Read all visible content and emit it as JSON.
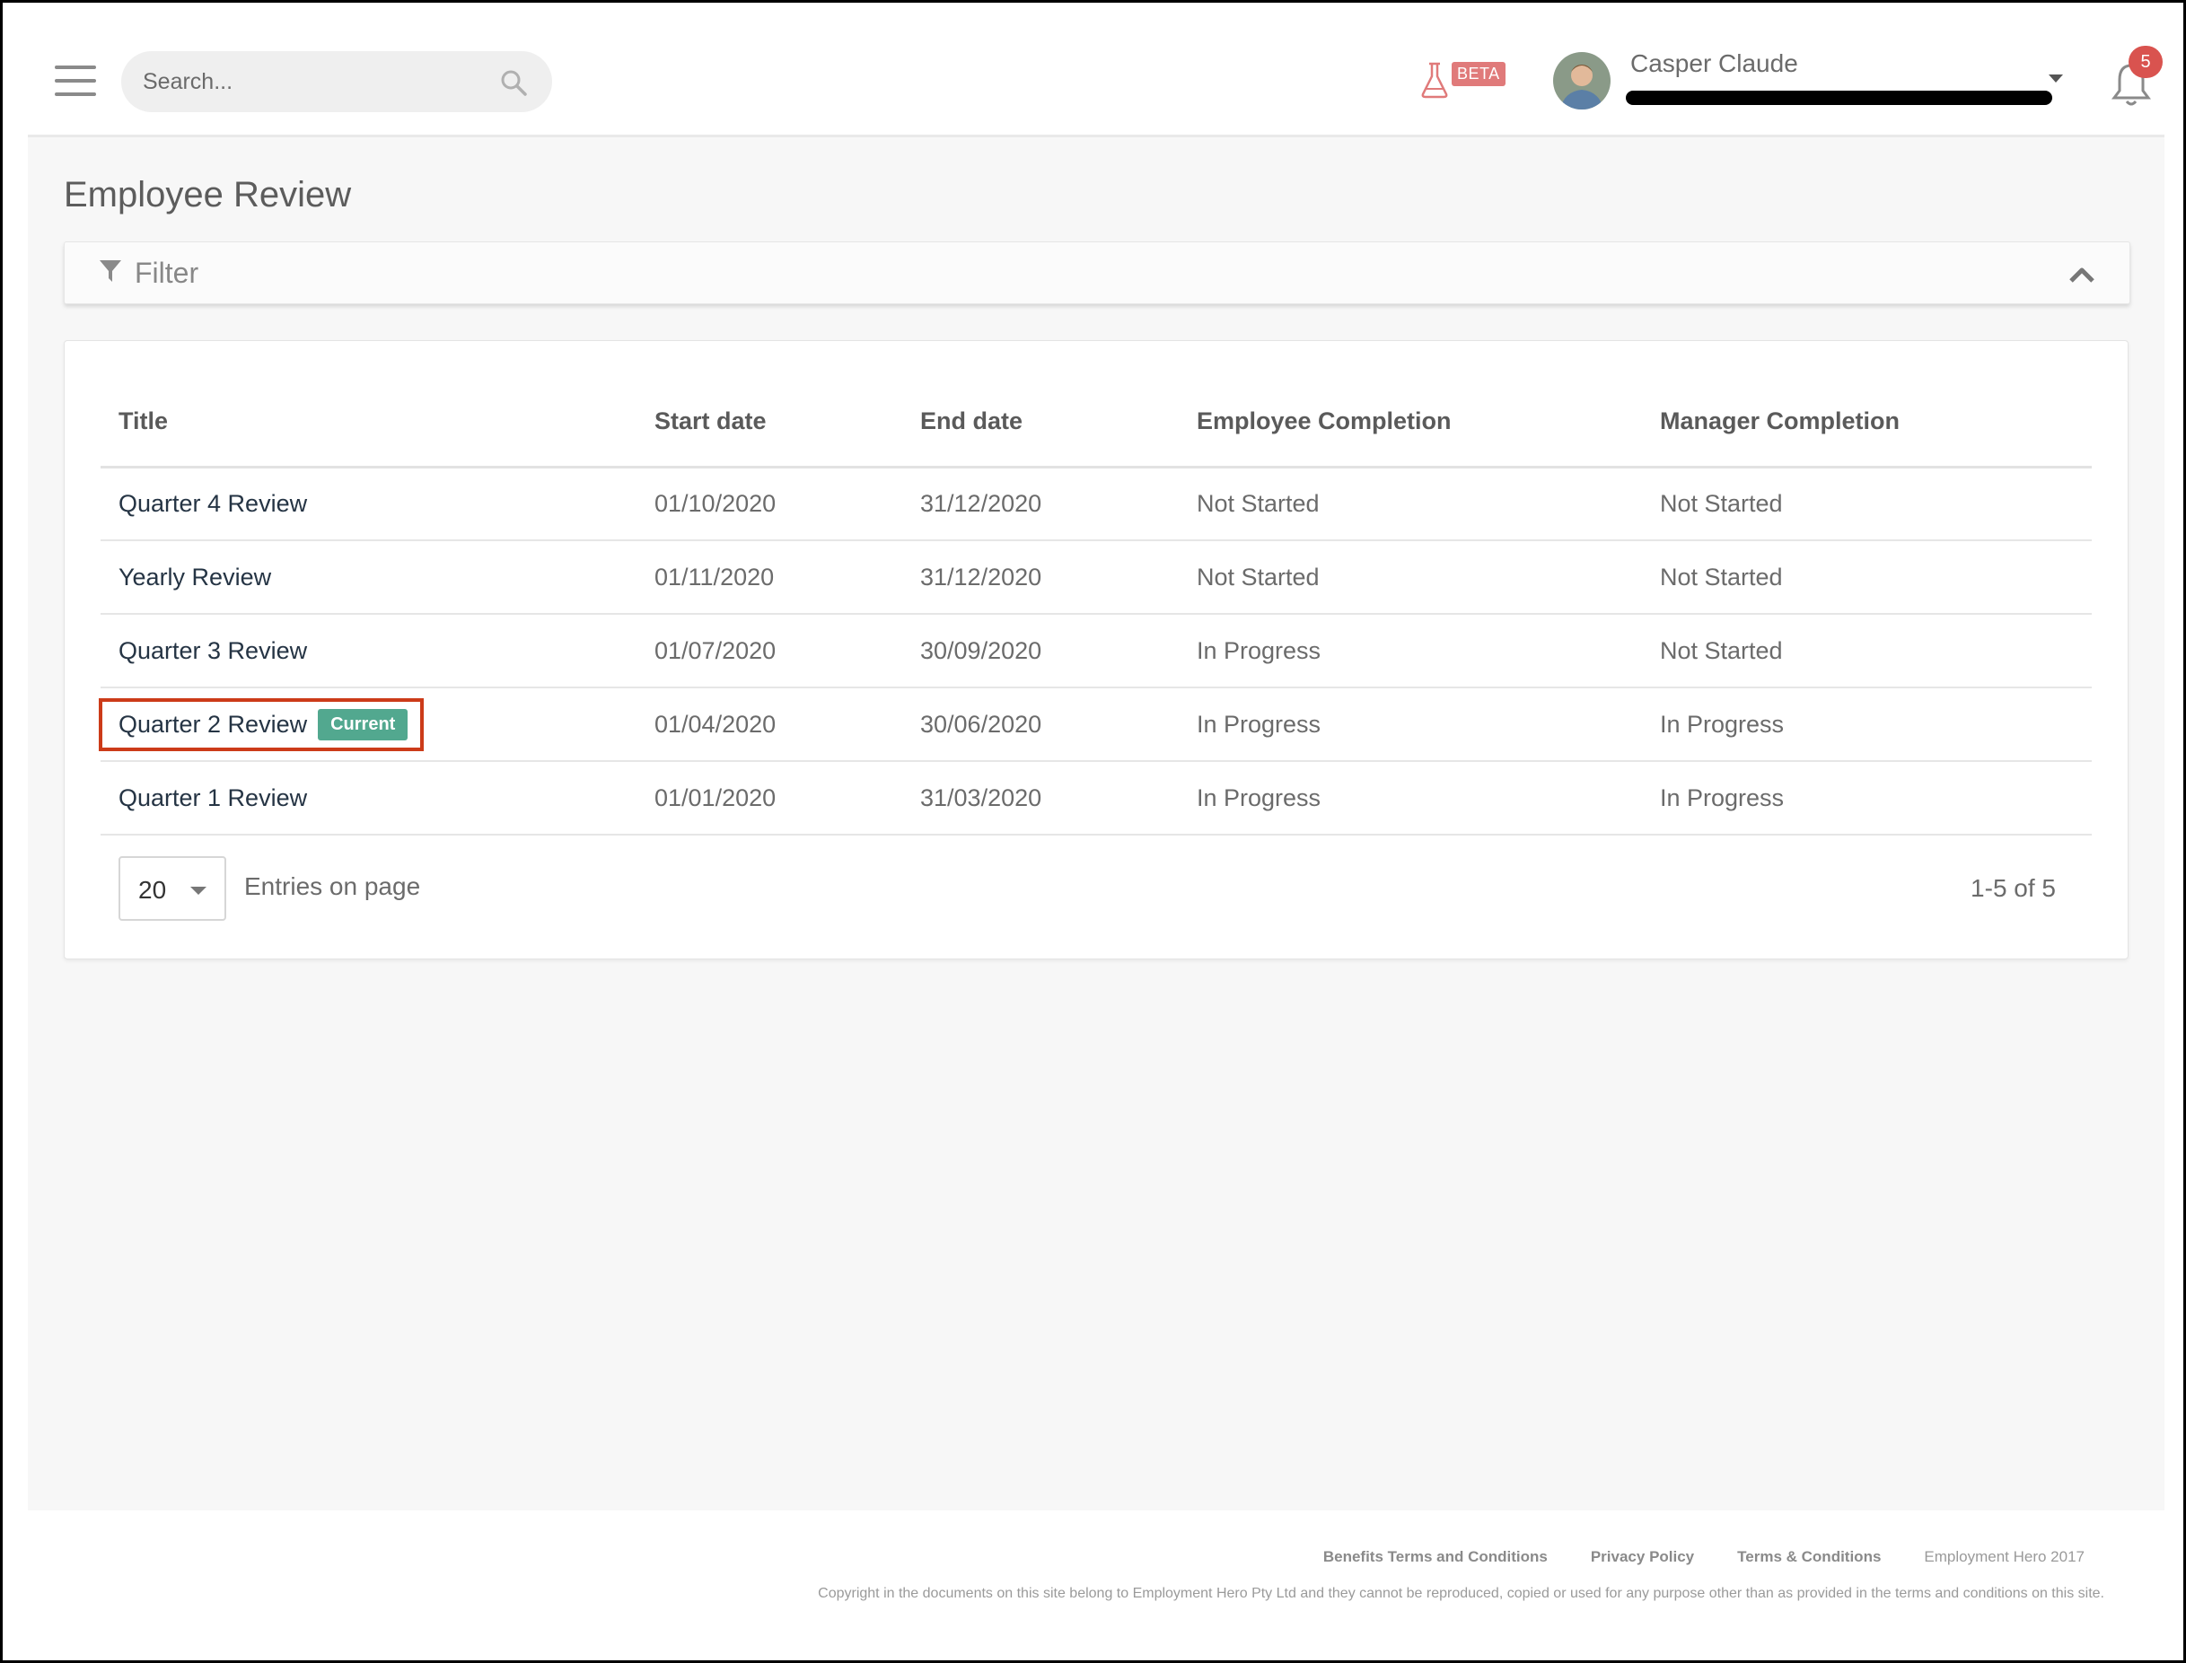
{
  "header": {
    "search_placeholder": "Search...",
    "beta_label": "BETA",
    "user_name": "Casper Claude",
    "notification_count": "5"
  },
  "page": {
    "title": "Employee Review",
    "filter_label": "Filter"
  },
  "table": {
    "columns": [
      "Title",
      "Start date",
      "End date",
      "Employee Completion",
      "Manager Completion"
    ],
    "rows": [
      {
        "title": "Quarter 4 Review",
        "start": "01/10/2020",
        "end": "31/12/2020",
        "employee": "Not Started",
        "manager": "Not Started"
      },
      {
        "title": "Yearly Review",
        "start": "01/11/2020",
        "end": "31/12/2020",
        "employee": "Not Started",
        "manager": "Not Started"
      },
      {
        "title": "Quarter 3 Review",
        "start": "01/07/2020",
        "end": "30/09/2020",
        "employee": "In Progress",
        "manager": "Not Started"
      },
      {
        "title": "Quarter 2 Review",
        "badge": "Current",
        "start": "01/04/2020",
        "end": "30/06/2020",
        "employee": "In Progress",
        "manager": "In Progress"
      },
      {
        "title": "Quarter 1 Review",
        "start": "01/01/2020",
        "end": "31/03/2020",
        "employee": "In Progress",
        "manager": "In Progress"
      }
    ]
  },
  "pagination": {
    "page_size": "20",
    "entries_label": "Entries on page",
    "range": "1-5 of 5"
  },
  "footer": {
    "links": [
      "Benefits Terms and Conditions",
      "Privacy Policy",
      "Terms & Conditions"
    ],
    "brand": "Employment Hero 2017",
    "copyright": "Copyright in the documents on this site belong to Employment Hero Pty Ltd and they cannot be reproduced, copied or used for any purpose other than as provided in the terms and conditions on this site."
  },
  "colors": {
    "badge_current": "#52a88f",
    "highlight_border": "#cc3b19",
    "notification": "#d9534f",
    "beta": "#e07a7a"
  },
  "icons": [
    "menu-icon",
    "search-icon",
    "flask-icon",
    "avatar",
    "caret-down-icon",
    "bell-icon",
    "filter-icon",
    "chevron-up-icon"
  ]
}
